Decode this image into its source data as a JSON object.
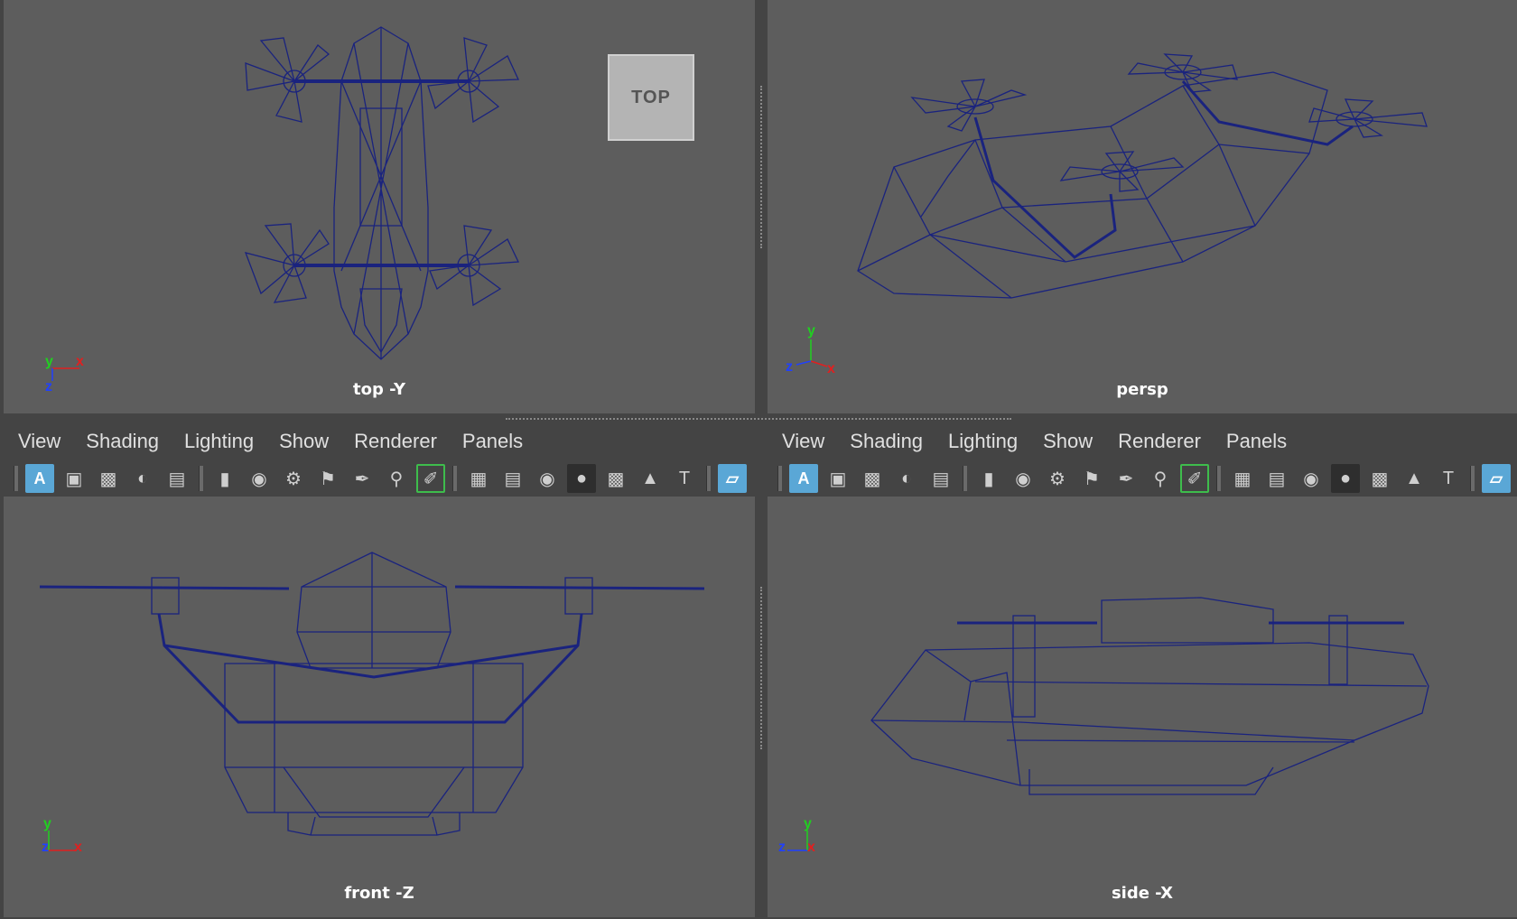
{
  "viewports": {
    "top": {
      "label": "top -Y",
      "cube": "TOP"
    },
    "persp": {
      "label": "persp"
    },
    "front": {
      "label": "front -Z"
    },
    "side": {
      "label": "side -X"
    }
  },
  "panel_menu": [
    "View",
    "Shading",
    "Lighting",
    "Show",
    "Renderer",
    "Panels"
  ],
  "axes": {
    "x": "x",
    "y": "y",
    "z": "z"
  },
  "colors": {
    "viewport_bg": "#5d5d5d",
    "wireframe": "#1a237e",
    "axis_x": "#e02020",
    "axis_y": "#20d020",
    "axis_z": "#2040ff",
    "ui_bg": "#444444"
  },
  "toolbar_icons": [
    "isolate-select-icon",
    "frame-icon",
    "grid-sel-icon",
    "shaded-sphere-icon",
    "layers-icon",
    "camera-icon",
    "lock-camera-icon",
    "camera-attr-icon",
    "bookmark-icon",
    "pen-tool-icon",
    "zoom-icon",
    "paint-brush-icon",
    "grid-icon",
    "film-gate-icon",
    "resolution-gate-icon",
    "gate-mask-icon",
    "field-chart-icon",
    "safe-action-icon",
    "text-icon",
    "viewcube-icon"
  ]
}
